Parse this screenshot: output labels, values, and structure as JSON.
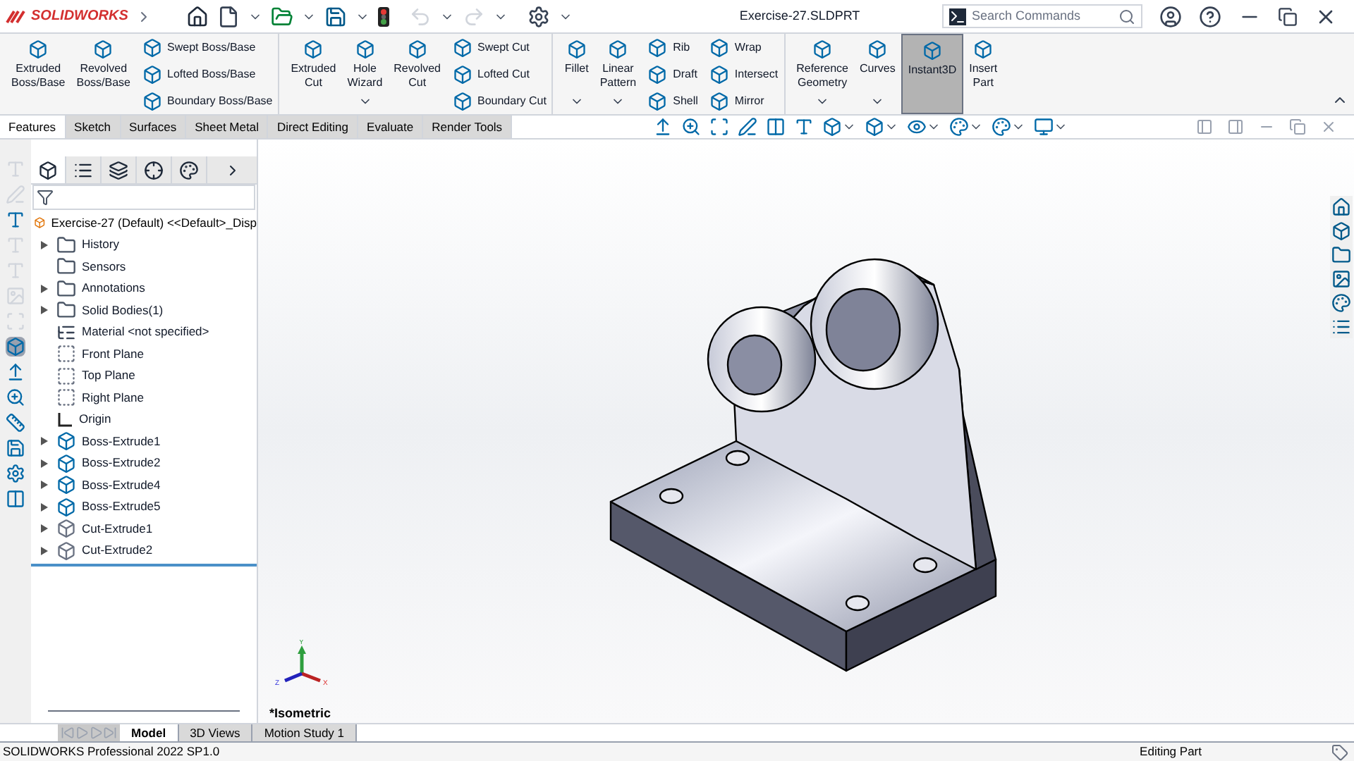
{
  "app": {
    "logo": "SOLIDWORKS"
  },
  "document_title": "Exercise-27.SLDPRT",
  "search": {
    "placeholder": "Search Commands"
  },
  "ribbon": [
    {
      "kind": "large",
      "label": "Extruded\nBoss/Base",
      "dropdown": false,
      "selected": false
    },
    {
      "kind": "large",
      "label": "Revolved\nBoss/Base",
      "dropdown": false,
      "selected": false
    },
    {
      "kind": "stack",
      "items": [
        "Swept Boss/Base",
        "Lofted Boss/Base",
        "Boundary Boss/Base"
      ],
      "divider": true
    },
    {
      "kind": "large",
      "label": "Extruded\nCut",
      "dropdown": false,
      "selected": false
    },
    {
      "kind": "large",
      "label": "Hole\nWizard",
      "dropdown": true,
      "selected": false
    },
    {
      "kind": "large",
      "label": "Revolved\nCut",
      "dropdown": false,
      "selected": false
    },
    {
      "kind": "stack",
      "items": [
        "Swept Cut",
        "Lofted Cut",
        "Boundary Cut"
      ],
      "divider": true
    },
    {
      "kind": "large",
      "label": "Fillet",
      "dropdown": true,
      "selected": false
    },
    {
      "kind": "large",
      "label": "Linear\nPattern",
      "dropdown": true,
      "selected": false
    },
    {
      "kind": "stack",
      "items": [
        "Rib",
        "Draft",
        "Shell"
      ],
      "divider": false
    },
    {
      "kind": "stack",
      "items": [
        "Wrap",
        "Intersect",
        "Mirror"
      ],
      "divider": true
    },
    {
      "kind": "large",
      "label": "Reference\nGeometry",
      "dropdown": true,
      "selected": false
    },
    {
      "kind": "large",
      "label": "Curves",
      "dropdown": true,
      "selected": false
    },
    {
      "kind": "large",
      "label": "Instant3D",
      "dropdown": false,
      "selected": true
    },
    {
      "kind": "large",
      "label": "Insert\nPart",
      "dropdown": false,
      "selected": false
    }
  ],
  "command_tabs": [
    {
      "label": "Features",
      "selected": true
    },
    {
      "label": "Sketch",
      "selected": false
    },
    {
      "label": "Surfaces",
      "selected": false
    },
    {
      "label": "Sheet Metal",
      "selected": false
    },
    {
      "label": "Direct Editing",
      "selected": false
    },
    {
      "label": "Evaluate",
      "selected": false
    },
    {
      "label": "Render Tools",
      "selected": false
    }
  ],
  "left_tools": [
    {
      "disabled": true
    },
    {
      "disabled": true
    },
    {
      "disabled": false
    },
    {
      "disabled": true
    },
    {
      "disabled": true
    },
    {
      "disabled": true
    },
    {
      "disabled": true
    },
    {
      "disabled": false
    },
    {
      "disabled": false
    },
    {
      "disabled": false
    },
    {
      "disabled": false
    },
    {
      "disabled": false
    },
    {
      "disabled": false
    },
    {
      "disabled": false
    }
  ],
  "feature_tree": {
    "root": "Exercise-27 (Default) <<Default>_Disp",
    "items": [
      {
        "label": "History",
        "kind": "folder",
        "expandable": true
      },
      {
        "label": "Sensors",
        "kind": "folder",
        "expandable": false
      },
      {
        "label": "Annotations",
        "kind": "folder",
        "expandable": true
      },
      {
        "label": "Solid Bodies(1)",
        "kind": "folder",
        "expandable": true
      },
      {
        "label": "Material <not specified>",
        "kind": "material",
        "expandable": false
      },
      {
        "label": "Front Plane",
        "kind": "plane",
        "expandable": false
      },
      {
        "label": "Top Plane",
        "kind": "plane",
        "expandable": false
      },
      {
        "label": "Right Plane",
        "kind": "plane",
        "expandable": false
      },
      {
        "label": "Origin",
        "kind": "origin",
        "expandable": false
      },
      {
        "label": "Boss-Extrude1",
        "kind": "boss",
        "expandable": true
      },
      {
        "label": "Boss-Extrude2",
        "kind": "boss",
        "expandable": true
      },
      {
        "label": "Boss-Extrude4",
        "kind": "boss",
        "expandable": true
      },
      {
        "label": "Boss-Extrude5",
        "kind": "boss",
        "expandable": true
      },
      {
        "label": "Cut-Extrude1",
        "kind": "cut",
        "expandable": true
      },
      {
        "label": "Cut-Extrude2",
        "kind": "cut",
        "expandable": true
      }
    ]
  },
  "triad": {
    "y": "Y",
    "z": "Z",
    "x": "X"
  },
  "view_name": "*Isometric",
  "bottom_tabs": [
    {
      "label": "Model",
      "selected": true
    },
    {
      "label": "3D Views",
      "selected": false
    },
    {
      "label": "Motion Study 1",
      "selected": false
    }
  ],
  "status": {
    "left": "SOLIDWORKS Professional 2022 SP1.0",
    "right": "Editing Part"
  }
}
